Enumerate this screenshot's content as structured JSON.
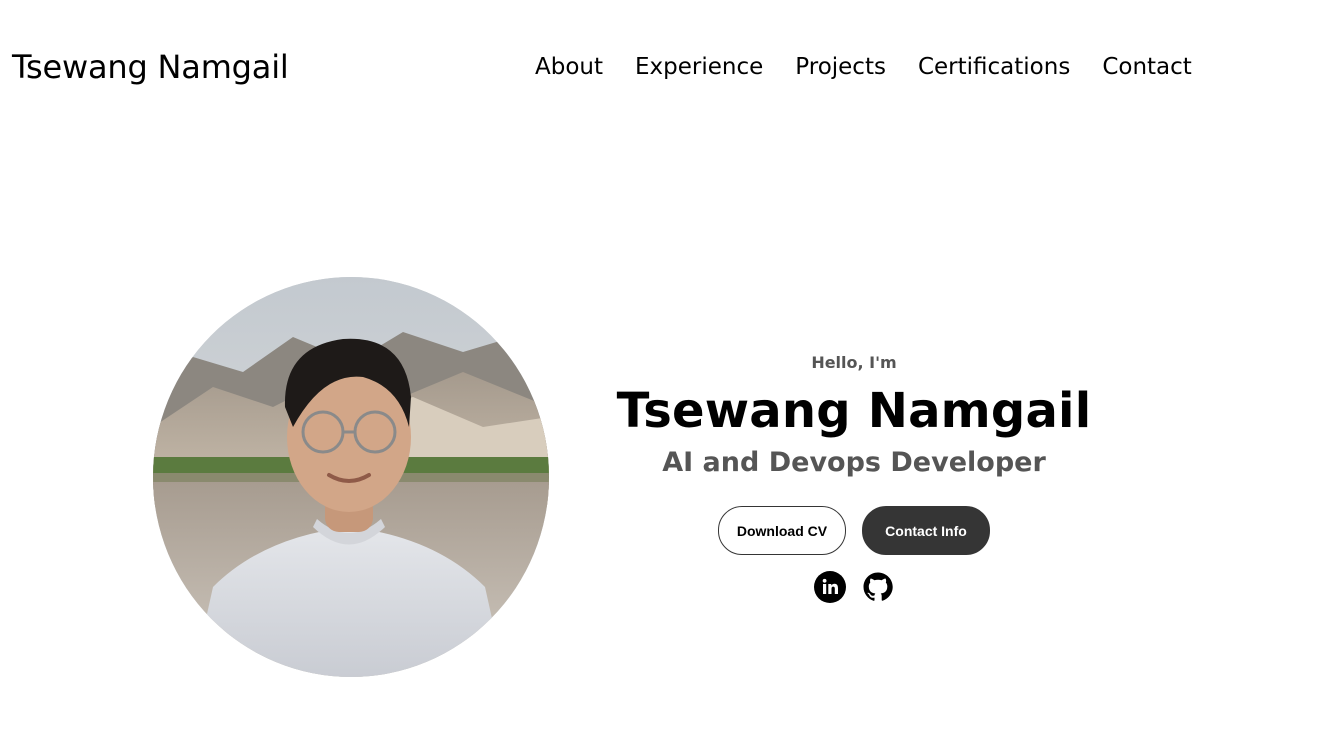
{
  "nav": {
    "logo": "Tsewang Namgail",
    "links": [
      "About",
      "Experience",
      "Projects",
      "Certifications",
      "Contact"
    ]
  },
  "hero": {
    "greeting": "Hello, I'm",
    "name": "Tsewang Namgail",
    "role": "AI and Devops Developer",
    "buttons": {
      "download_cv": "Download CV",
      "contact_info": "Contact Info"
    },
    "social_icons": [
      "linkedin-icon",
      "github-icon"
    ]
  },
  "colors": {
    "text_primary": "#000000",
    "text_secondary": "#555555",
    "button_dark": "#353535",
    "background": "#ffffff"
  }
}
